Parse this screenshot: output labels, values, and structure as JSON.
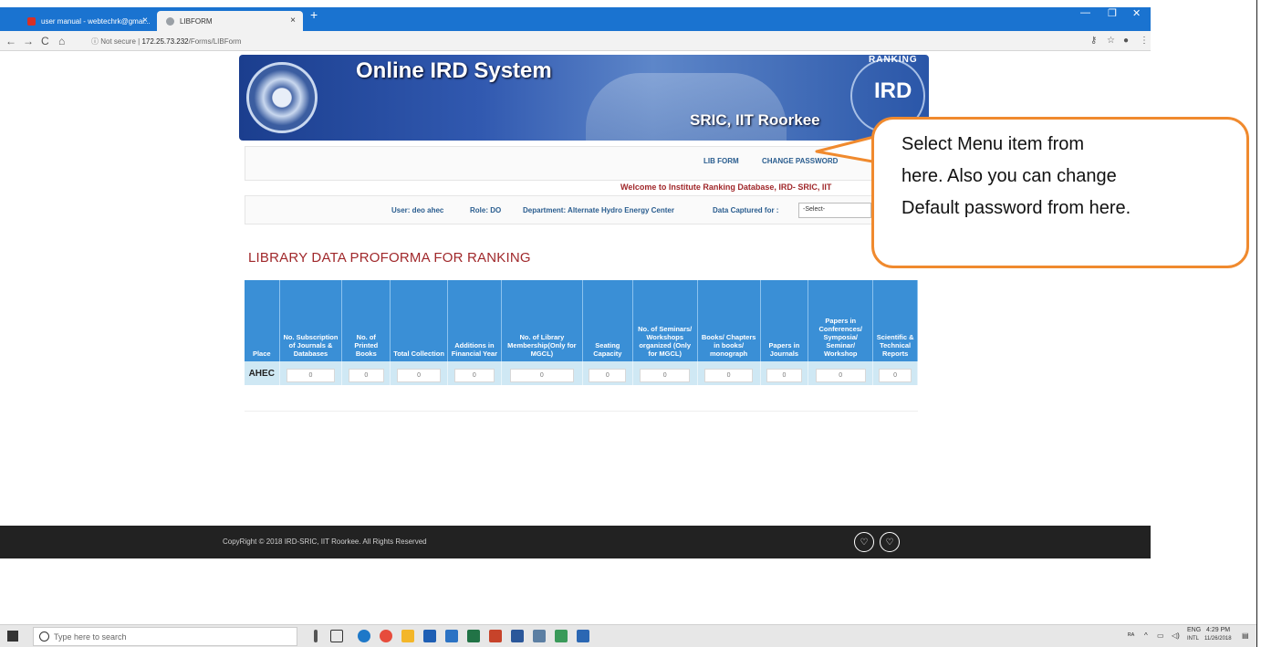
{
  "browser": {
    "tabs": [
      {
        "title": "user manual - webtechrk@gmai...",
        "close": "×"
      },
      {
        "title": "LIBFORM",
        "close": "×"
      }
    ],
    "new_tab": "+",
    "url_security": "ⓘ Not secure",
    "url_host": "172.25.73.232",
    "url_path": "/Forms/LIBForm",
    "window_controls": [
      "—",
      "❐",
      "✕"
    ]
  },
  "banner": {
    "title": "Online IRD System",
    "subtitle": "SRIC, IIT Roorkee",
    "logo_text": "IRD",
    "logo_ring": "RANKING"
  },
  "menu": {
    "items": [
      "LIB FORM",
      "CHANGE PASSWORD"
    ]
  },
  "welcome": "Welcome to Institute Ranking Database, IRD- SRIC, IIT",
  "user_info": {
    "user": "User: deo ahec",
    "role": "Role: DO",
    "department": "Department: Alternate Hydro Energy Center",
    "captured_label": "Data Captured for :",
    "captured_value": "-Select-"
  },
  "heading": "LIBRARY DATA PROFORMA FOR RANKING",
  "table": {
    "columns": [
      "Place",
      "No. Subscription of Journals & Databases",
      "No. of Printed Books",
      "Total Collection",
      "Additions in Financial Year",
      "No. of Library Membership(Only for MGCL)",
      "Seating Capacity",
      "No. of Seminars/ Workshops organized (Only for MGCL)",
      "Books/ Chapters in books/ monograph",
      "Papers in Journals",
      "Papers in Conferences/ Symposia/ Seminar/ Workshop",
      "Scientific & Technical Reports"
    ],
    "rows": [
      {
        "place": "AHEC",
        "values": [
          "0",
          "0",
          "0",
          "0",
          "0",
          "0",
          "0",
          "0",
          "0",
          "0",
          "0"
        ]
      }
    ]
  },
  "footer": {
    "copyright": "CopyRight © 2018 IRD-SRIC, IIT Roorkee. All Rights Reserved"
  },
  "callout": {
    "line1": "Select  Menu item from",
    "line2": "here. Also you can change",
    "line3": "Default password from here."
  },
  "taskbar": {
    "search_placeholder": "Type here to search",
    "lang": "ENG",
    "lang2": "INTL",
    "time": "4:29 PM",
    "date": "11/26/2018"
  },
  "colors": {
    "chrome_blue": "#1a73d0",
    "table_header": "#3a8fd6",
    "table_row": "#cfe8f4",
    "heading_red": "#a0282b",
    "callout_border": "#f08a2e",
    "footer_bg": "#222222"
  }
}
